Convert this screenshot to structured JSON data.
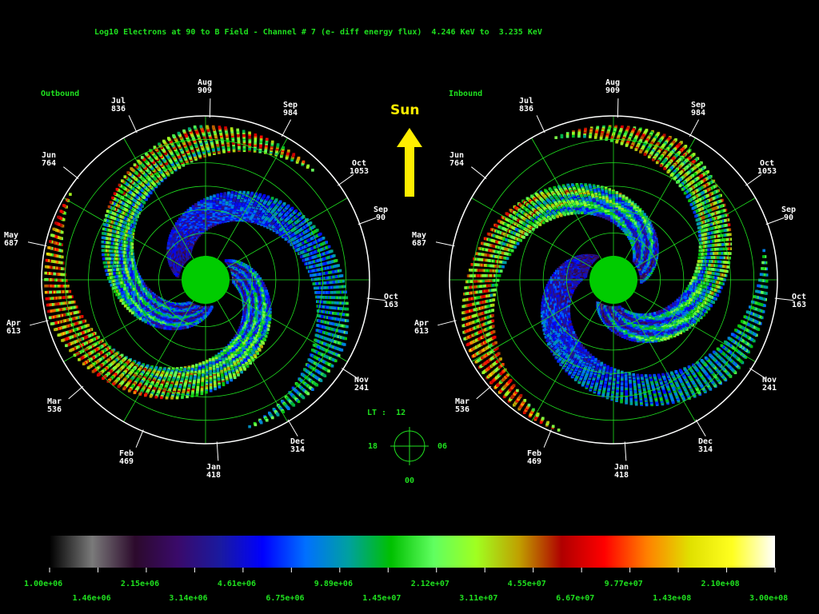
{
  "title": "Log10 Electrons at 90 to B Field - Channel # 7 (e- diff energy flux)  4.246 KeV to  3.235 KeV",
  "sun_label": "Sun",
  "colors": {
    "grid": "#1fe01f",
    "ring": "#ffffff",
    "planet": "#00cc00",
    "sun_arrow": "#ffee00",
    "text": "#1fe01f"
  },
  "lt_key": {
    "title": "LT :  12",
    "left": "18",
    "right": "06",
    "bottom": "00"
  },
  "chart_data": [
    {
      "type": "heatmap",
      "panel": "Outbound",
      "title": "Outbound",
      "time_labels": [
        {
          "month": "Sep",
          "day": "90"
        },
        {
          "month": "Oct",
          "day": "163"
        },
        {
          "month": "Nov",
          "day": "241"
        },
        {
          "month": "Dec",
          "day": "314"
        },
        {
          "month": "Jan",
          "day": "418"
        },
        {
          "month": "Feb",
          "day": "469"
        },
        {
          "month": "Mar",
          "day": "536"
        },
        {
          "month": "Apr",
          "day": "613"
        },
        {
          "month": "May",
          "day": "687"
        },
        {
          "month": "Jun",
          "day": "764"
        },
        {
          "month": "Jul",
          "day": "836"
        },
        {
          "month": "Aug",
          "day": "909"
        },
        {
          "month": "Sep",
          "day": "984"
        },
        {
          "month": "Oct",
          "day": "1053"
        }
      ]
    },
    {
      "type": "heatmap",
      "panel": "Inbound",
      "title": "Inbound",
      "time_labels": [
        {
          "month": "Sep",
          "day": "90"
        },
        {
          "month": "Oct",
          "day": "163"
        },
        {
          "month": "Nov",
          "day": "241"
        },
        {
          "month": "Dec",
          "day": "314"
        },
        {
          "month": "Jan",
          "day": "418"
        },
        {
          "month": "Feb",
          "day": "469"
        },
        {
          "month": "Mar",
          "day": "536"
        },
        {
          "month": "Apr",
          "day": "613"
        },
        {
          "month": "May",
          "day": "687"
        },
        {
          "month": "Jun",
          "day": "764"
        },
        {
          "month": "Jul",
          "day": "836"
        },
        {
          "month": "Aug",
          "day": "909"
        },
        {
          "month": "Sep",
          "day": "984"
        },
        {
          "month": "Oct",
          "day": "1053"
        }
      ]
    }
  ],
  "colorbar": {
    "min": 1000000.0,
    "max": 300000000.0,
    "scale": "log",
    "ticks_top": [
      "1.00e+06",
      "2.15e+06",
      "4.61e+06",
      "9.89e+06",
      "2.12e+07",
      "4.55e+07",
      "9.77e+07",
      "2.10e+08"
    ],
    "ticks_bottom": [
      "1.46e+06",
      "3.14e+06",
      "6.75e+06",
      "1.45e+07",
      "3.11e+07",
      "6.67e+07",
      "1.43e+08",
      "3.00e+08"
    ],
    "stops": [
      "#000000",
      "#7a7a7a",
      "#2c0a2c",
      "#3a0a6a",
      "#1a1aa0",
      "#0000ff",
      "#0070ff",
      "#00a0a0",
      "#00c000",
      "#60ff60",
      "#a0ff20",
      "#c0a000",
      "#b00000",
      "#ff0000",
      "#ff8000",
      "#e0e000",
      "#ffff20",
      "#ffffff"
    ]
  }
}
